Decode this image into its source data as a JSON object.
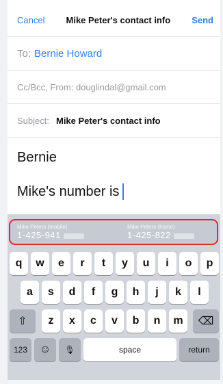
{
  "header": {
    "cancel": "Cancel",
    "title": "Mike Peter's contact info",
    "send": "Send"
  },
  "to": {
    "label": "To:",
    "value": "Bernie Howard"
  },
  "ccbcc": {
    "text": "Cc/Bcc, From: douglindal@gmail.com"
  },
  "subject": {
    "label": "Subject:",
    "value": "Mike Peter's contact info"
  },
  "body": {
    "greeting": "Bernie",
    "line": "Mike's number is"
  },
  "suggestions": [
    {
      "label": "Mike Peters (mobile)",
      "number": "1-425-941"
    },
    {
      "label": "Mike Peters (home)",
      "number": "1-425-822"
    }
  ],
  "keyboard": {
    "row1": [
      "q",
      "w",
      "e",
      "r",
      "t",
      "y",
      "u",
      "i",
      "o",
      "p"
    ],
    "row2": [
      "a",
      "s",
      "d",
      "f",
      "g",
      "h",
      "j",
      "k",
      "l"
    ],
    "row3": [
      "z",
      "x",
      "c",
      "v",
      "b",
      "n",
      "m"
    ],
    "shift": "⇧",
    "delete": "⌫",
    "numbers": "123",
    "emoji": "☺",
    "mic": "🎙",
    "space": "space",
    "return": "return"
  },
  "colors": {
    "accent": "#2f80ed",
    "highlight_border": "#d4302a",
    "keyboard_bg": "#d1d5db"
  }
}
